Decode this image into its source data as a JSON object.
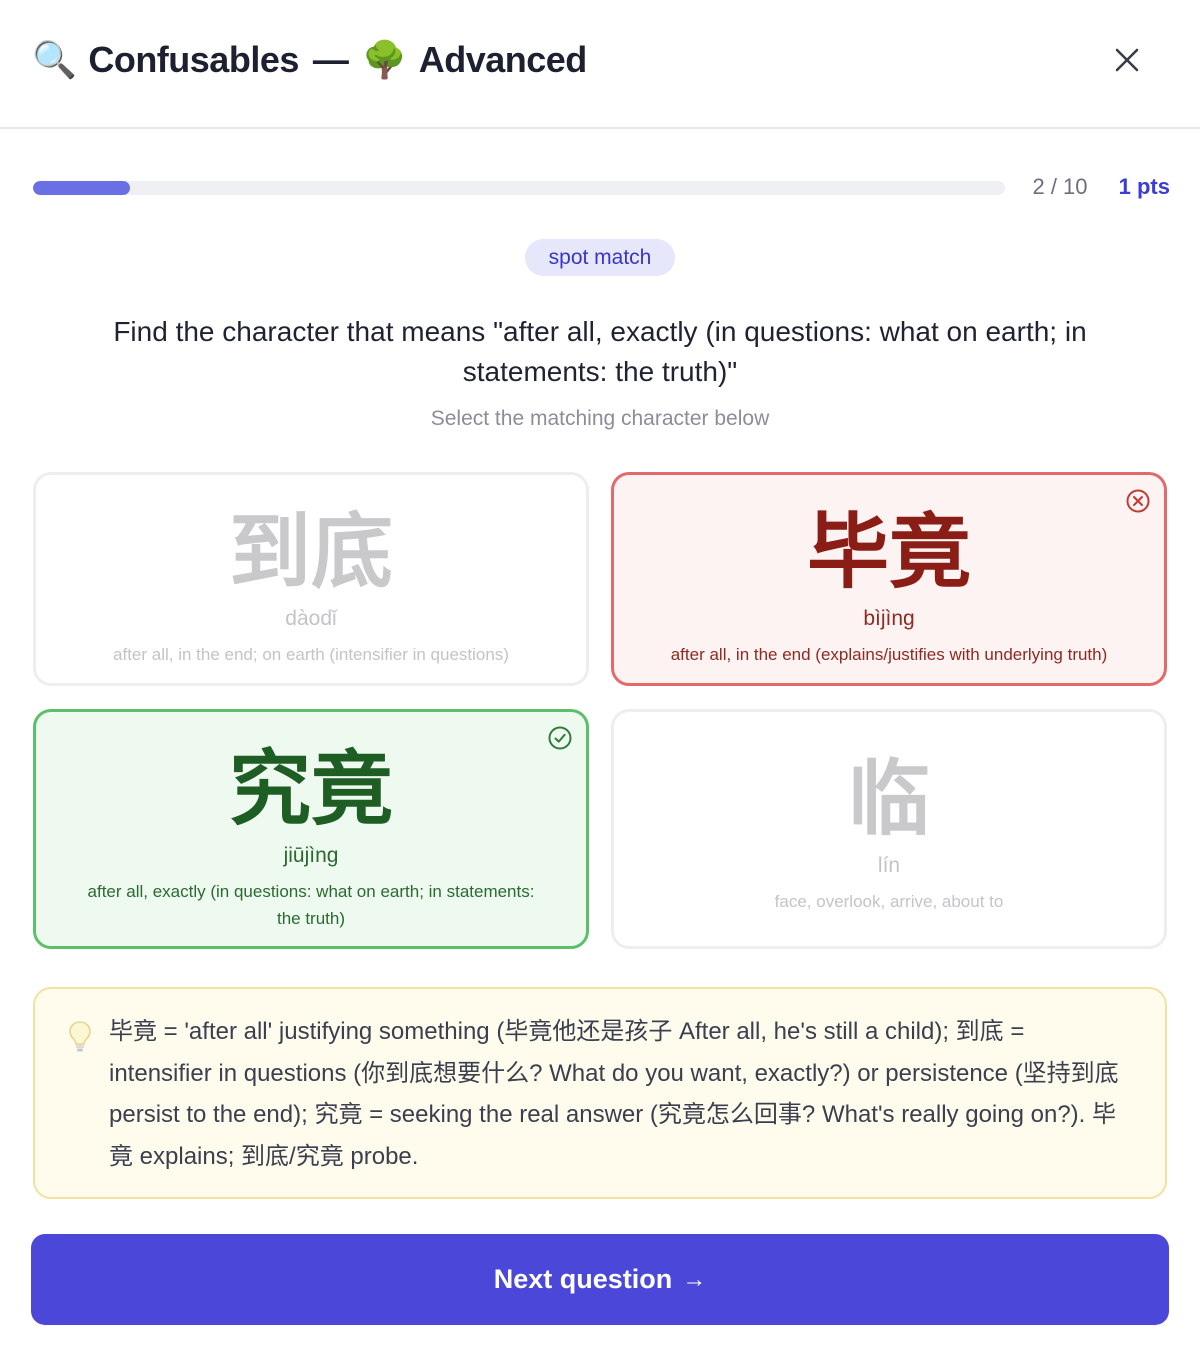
{
  "header": {
    "title_icon": "🔍",
    "title": "Confusables",
    "separator": "—",
    "level_icon": "🌳",
    "level": "Advanced",
    "close_icon": "close-icon"
  },
  "progress": {
    "count": "2 / 10",
    "points": "1 pts",
    "fraction": 0.1
  },
  "badge": "spot match",
  "question": "Find the character that means \"after all, exactly (in questions: what on earth; in statements: the truth)\"",
  "subtitle": "Select the matching character below",
  "options": [
    {
      "hanzi": "到底",
      "pinyin": "dàodǐ",
      "meaning": "after all, in the end; on earth (intensifier in questions)",
      "state": "dim"
    },
    {
      "hanzi": "毕竟",
      "pinyin": "bìjìng",
      "meaning": "after all, in the end (explains/justifies with underlying truth)",
      "state": "wrong"
    },
    {
      "hanzi": "究竟",
      "pinyin": "jiūjìng",
      "meaning": "after all, exactly (in questions: what on earth; in statements: the truth)",
      "state": "correct"
    },
    {
      "hanzi": "临",
      "pinyin": "lín",
      "meaning": "face, overlook, arrive, about to",
      "state": "dim"
    }
  ],
  "hint": {
    "icon": "lightbulb-icon",
    "text": "毕竟 = 'after all' justifying something (毕竟他还是孩子 After all, he's still a child); 到底 = intensifier in questions (你到底想要什么? What do you want, exactly?) or persistence (坚持到底 persist to the end); 究竟 = seeking the real answer (究竟怎么回事? What's really going on?). 毕竟 explains; 到底/究竟 probe."
  },
  "next_button": {
    "label": "Next question",
    "arrow": "→"
  },
  "colors": {
    "accent": "#4a47d9",
    "wrong": "#e26a6a",
    "correct": "#5cbf6a"
  }
}
